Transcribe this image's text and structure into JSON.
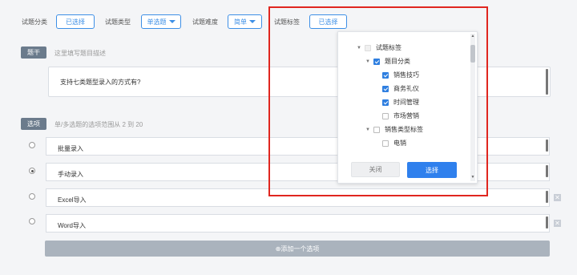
{
  "filters": {
    "category_label": "试题分类",
    "category_value": "已选择",
    "type_label": "试题类型",
    "type_value": "单选题",
    "difficulty_label": "试题难度",
    "difficulty_value": "简单",
    "tag_label": "试题标签",
    "tag_value": "已选择"
  },
  "stem": {
    "tag": "题干",
    "hint": "这里填写题目描述",
    "content": "支持七类题型录入的方式有?"
  },
  "options": {
    "tag": "选项",
    "hint": "单/多选题的选项范围从 2 到 20",
    "items": [
      {
        "text": "批量录入",
        "selected": false
      },
      {
        "text": "手动录入",
        "selected": true
      },
      {
        "text": "Excel导入",
        "selected": false
      },
      {
        "text": "Word导入",
        "selected": false
      }
    ],
    "add_label": "⊕添加一个选项"
  },
  "tag_popup": {
    "tree": [
      {
        "label": "试题标签",
        "level": 0,
        "checked": false,
        "disabled": true,
        "toggle": "▼"
      },
      {
        "label": "题目分类",
        "level": 1,
        "checked": true,
        "disabled": false,
        "toggle": "▼"
      },
      {
        "label": "销售技巧",
        "level": 2,
        "checked": true,
        "disabled": false,
        "toggle": ""
      },
      {
        "label": "商务礼仪",
        "level": 2,
        "checked": true,
        "disabled": false,
        "toggle": ""
      },
      {
        "label": "时间管理",
        "level": 2,
        "checked": true,
        "disabled": false,
        "toggle": ""
      },
      {
        "label": "市场营销",
        "level": 2,
        "checked": false,
        "disabled": false,
        "toggle": ""
      },
      {
        "label": "销售类型标签",
        "level": 1,
        "checked": false,
        "disabled": false,
        "toggle": "▼"
      },
      {
        "label": "电销",
        "level": 2,
        "checked": false,
        "disabled": false,
        "toggle": ""
      }
    ],
    "close_label": "关闭",
    "confirm_label": "选择"
  },
  "colors": {
    "accent": "#3d8fe6",
    "highlight_border": "#e0261f"
  }
}
